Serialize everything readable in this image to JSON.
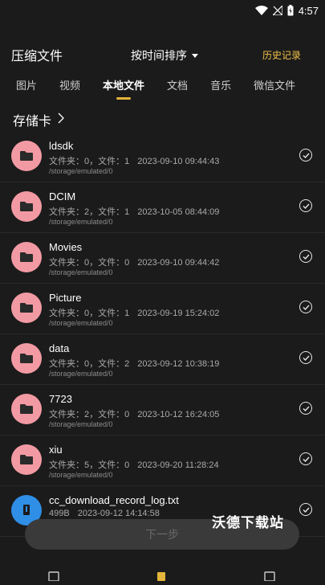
{
  "status": {
    "time": "4:57"
  },
  "header": {
    "title": "压缩文件",
    "sort_label": "按时间排序",
    "history_label": "历史记录"
  },
  "tabs": [
    {
      "label": "图片",
      "active": false
    },
    {
      "label": "视频",
      "active": false
    },
    {
      "label": "本地文件",
      "active": true
    },
    {
      "label": "文档",
      "active": false
    },
    {
      "label": "音乐",
      "active": false
    },
    {
      "label": "微信文件",
      "active": false
    }
  ],
  "breadcrumb": {
    "label": "存储卡"
  },
  "files": [
    {
      "name": "ldsdk",
      "meta": "文件夹：0，文件：1",
      "date": "2023-09-10 09:44:43",
      "path": "/storage/emulated/0",
      "icon": "folder-icon"
    },
    {
      "name": "DCIM",
      "meta": "文件夹：2，文件：1",
      "date": "2023-10-05 08:44:09",
      "path": "/storage/emulated/0",
      "icon": "folder-icon"
    },
    {
      "name": "Movies",
      "meta": "文件夹：0，文件：0",
      "date": "2023-09-10 09:44:42",
      "path": "/storage/emulated/0",
      "icon": "folder-icon"
    },
    {
      "name": "Picture",
      "meta": "文件夹：0，文件：1",
      "date": "2023-09-19 15:24:02",
      "path": "/storage/emulated/0",
      "icon": "folder-icon"
    },
    {
      "name": "data",
      "meta": "文件夹：0，文件：2",
      "date": "2023-09-12 10:38:19",
      "path": "/storage/emulated/0",
      "icon": "folder-icon"
    },
    {
      "name": "7723",
      "meta": "文件夹：2，文件：0",
      "date": "2023-10-12 16:24:05",
      "path": "/storage/emulated/0",
      "icon": "folder-icon"
    },
    {
      "name": "xiu",
      "meta": "文件夹：5，文件：0",
      "date": "2023-09-20 11:28:24",
      "path": "/storage/emulated/0",
      "icon": "folder-icon"
    },
    {
      "name": "cc_download_record_log.txt",
      "meta": "499B",
      "date": "2023-09-12 14:14:58",
      "path": "",
      "icon": "text-file-icon"
    }
  ],
  "next_button": {
    "label": "下一步"
  },
  "watermark": {
    "text": "沃德下载站"
  },
  "colors": {
    "accent": "#e5b43a",
    "folder": "#f29aa3",
    "file": "#2f8ee6",
    "background": "#1b1b1b"
  }
}
